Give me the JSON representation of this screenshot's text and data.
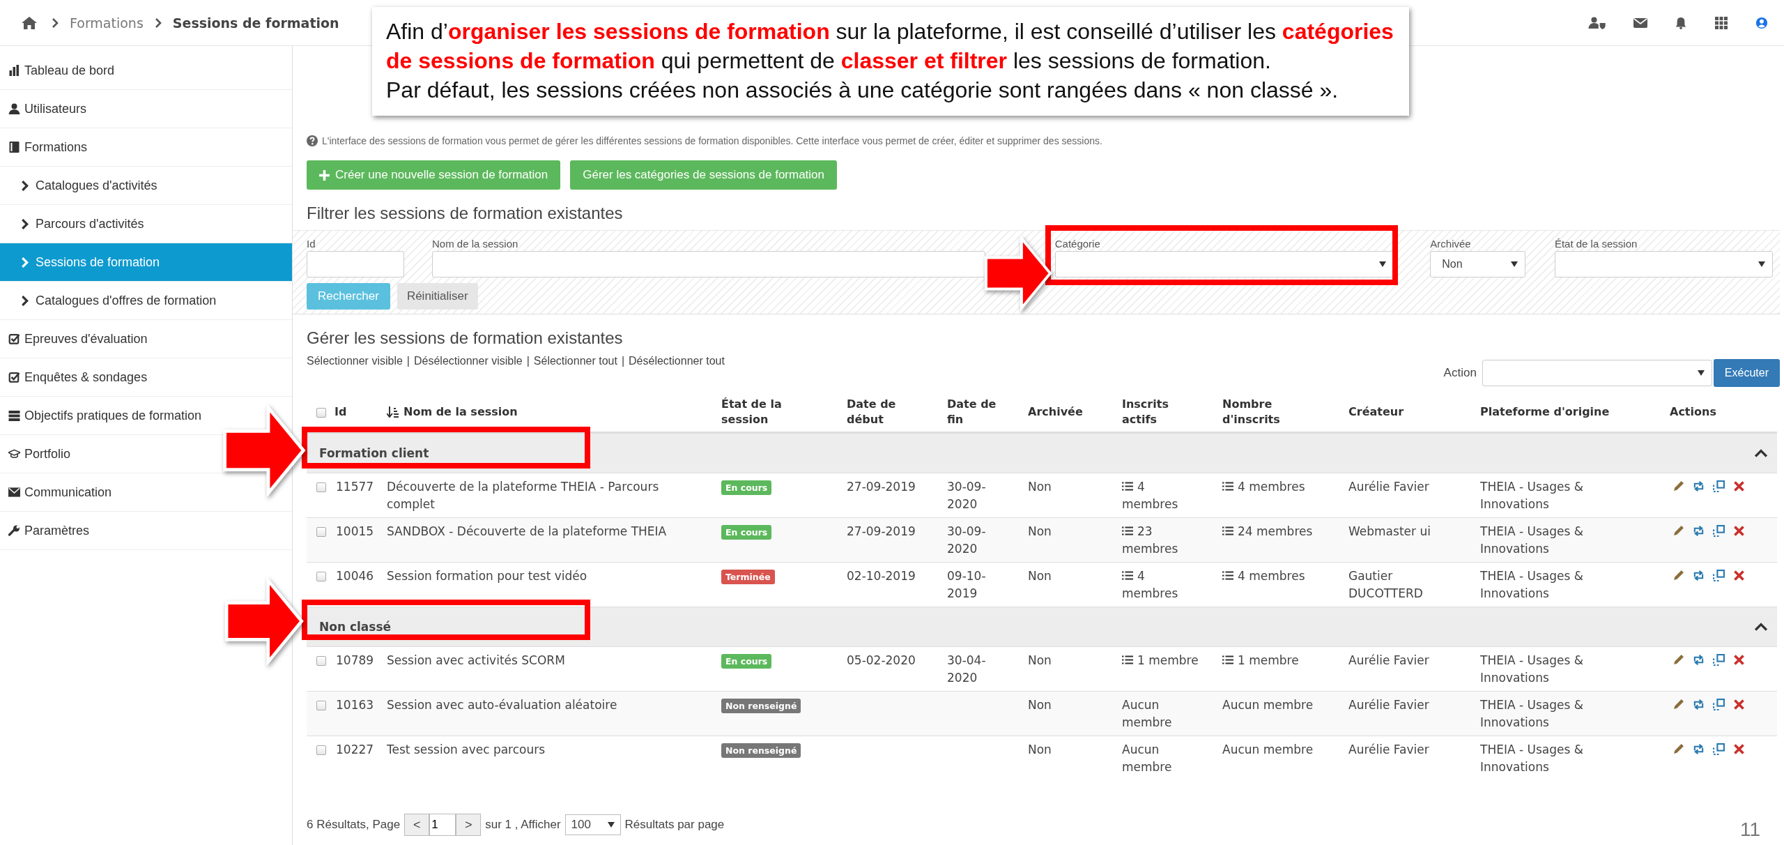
{
  "breadcrumb": {
    "items": [
      "Formations",
      "Sessions de formation"
    ]
  },
  "sidebar": {
    "items": [
      {
        "label": "Tableau de bord",
        "kind": "section",
        "selected": false
      },
      {
        "label": "Utilisateurs",
        "kind": "section",
        "selected": false
      },
      {
        "label": "Formations",
        "kind": "section",
        "selected": false
      },
      {
        "label": "Catalogues d'activités",
        "kind": "sub",
        "selected": false
      },
      {
        "label": "Parcours d'activités",
        "kind": "sub",
        "selected": false
      },
      {
        "label": "Sessions de formation",
        "kind": "sub",
        "selected": true
      },
      {
        "label": "Catalogues d'offres de formation",
        "kind": "sub",
        "selected": false
      },
      {
        "label": "Epreuves d'évaluation",
        "kind": "section",
        "selected": false
      },
      {
        "label": "Enquêtes & sondages",
        "kind": "section",
        "selected": false
      },
      {
        "label": "Objectifs pratiques de formation",
        "kind": "section",
        "selected": false
      },
      {
        "label": "Portfolio",
        "kind": "section",
        "selected": false
      },
      {
        "label": "Communication",
        "kind": "section",
        "selected": false
      },
      {
        "label": "Paramètres",
        "kind": "section",
        "selected": false
      }
    ]
  },
  "callout": {
    "lines": [
      "Afin d’**organiser les sessions de formation** sur la plateforme, il est conseillé d’utiliser les **catégories**",
      "**de sessions de formation** qui permettent de **classer et filtrer** les sessions de formation.",
      "Par défaut, les sessions créées non associés à une catégorie sont rangées dans « non classé »."
    ]
  },
  "info_text": "L'interface des sessions de formation vous permet de gérer les différentes sessions de formation disponibles. Cette interface vous permet de créer, éditer et supprimer des sessions.",
  "buttons": [
    {
      "label": "Créer une nouvelle session de formation",
      "kind": "add"
    },
    {
      "label": "Gérer les catégories de sessions de formation",
      "kind": "plain"
    }
  ],
  "filter": {
    "title": "Filtrer les sessions de formation existantes",
    "fields": [
      {
        "label": "Id",
        "kind": "text"
      },
      {
        "label": "Nom de la session",
        "kind": "text"
      },
      {
        "label": "Catégorie",
        "kind": "select"
      },
      {
        "label": "Archivée",
        "kind": "select",
        "value": "Non"
      },
      {
        "label": "État de la session",
        "kind": "select"
      }
    ],
    "search_button": "Rechercher",
    "reset_button": "Réinitialiser"
  },
  "manage": {
    "title": "Gérer les sessions de formation existantes",
    "select_links": [
      "Sélectionner visible",
      "Désélectionner visible",
      "Sélectionner tout",
      "Désélectionner tout"
    ],
    "link_separator": "|",
    "action_label": "Action",
    "execute_button": "Exécuter"
  },
  "table": {
    "header_checked": false,
    "columns": [
      {
        "label": "Id",
        "sorted": false
      },
      {
        "label": "Nom de la session",
        "sorted": true
      },
      {
        "label": "État de la session",
        "sorted": false
      },
      {
        "label": "Date de début",
        "sorted": false
      },
      {
        "label": "Date de fin",
        "sorted": false
      },
      {
        "label": "Archivée",
        "sorted": false
      },
      {
        "label": "Inscrits actifs",
        "sorted": false
      },
      {
        "label": "Nombre d'inscrits",
        "sorted": false
      },
      {
        "label": "Créateur",
        "sorted": false
      },
      {
        "label": "Plateforme d'origine",
        "sorted": false
      },
      {
        "label": "Actions",
        "sorted": false
      }
    ],
    "groups": [
      {
        "name": "Formation client",
        "expanded": true,
        "rows": [
          {
            "checked": false,
            "id": "11577",
            "name": "Découverte de la plateforme THEIA - Parcours complet",
            "status": {
              "label": "En cours",
              "kind": "running"
            },
            "start": "27-09-2019",
            "end": "30-09-2020",
            "archived": "Non",
            "active": "4 membres",
            "count": "4 membres",
            "list_icon": true,
            "creator": "Aurélie Favier",
            "platform": "THEIA - Usages & Innovations"
          },
          {
            "checked": false,
            "id": "10015",
            "name": "SANDBOX - Découverte de la plateforme THEIA",
            "status": {
              "label": "En cours",
              "kind": "running"
            },
            "start": "27-09-2019",
            "end": "30-09-2020",
            "archived": "Non",
            "active": "23 membres",
            "count": "24 membres",
            "list_icon": true,
            "creator": "Webmaster ui",
            "platform": "THEIA - Usages & Innovations"
          },
          {
            "checked": false,
            "id": "10046",
            "name": "Session formation pour test vidéo",
            "status": {
              "label": "Terminée",
              "kind": "finished"
            },
            "start": "02-10-2019",
            "end": "09-10-2019",
            "archived": "Non",
            "active": "4 membres",
            "count": "4 membres",
            "list_icon": true,
            "creator": "Gautier DUCOTTERD",
            "platform": "THEIA - Usages & Innovations"
          }
        ]
      },
      {
        "name": "Non classé",
        "expanded": true,
        "rows": [
          {
            "checked": false,
            "id": "10789",
            "name": "Session avec activités SCORM",
            "status": {
              "label": "En cours",
              "kind": "running"
            },
            "start": "05-02-2020",
            "end": "30-04-2020",
            "archived": "Non",
            "active": "1 membre",
            "count": "1 membre",
            "list_icon": true,
            "creator": "Aurélie Favier",
            "platform": "THEIA - Usages & Innovations"
          },
          {
            "checked": false,
            "id": "10163",
            "name": "Session avec auto-évaluation aléatoire",
            "status": {
              "label": "Non renseigné",
              "kind": "unset"
            },
            "archived": "Non",
            "active": "Aucun membre",
            "count": "Aucun membre",
            "list_icon": false,
            "creator": "Aurélie Favier",
            "platform": "THEIA - Usages & Innovations"
          },
          {
            "checked": false,
            "id": "10227",
            "name": "Test session avec parcours",
            "status": {
              "label": "Non renseigné",
              "kind": "unset"
            },
            "archived": "Non",
            "active": "Aucun membre",
            "count": "Aucun membre",
            "list_icon": false,
            "creator": "Aurélie Favier",
            "platform": "THEIA - Usages & Innovations"
          }
        ]
      }
    ]
  },
  "pagination": {
    "summary": "6 Résultats, Page",
    "prev": "<",
    "page": "1",
    "next": ">",
    "of": "sur 1 , Afficher",
    "per_page": "100",
    "suffix": "Résultats par page"
  },
  "page_number": "11"
}
